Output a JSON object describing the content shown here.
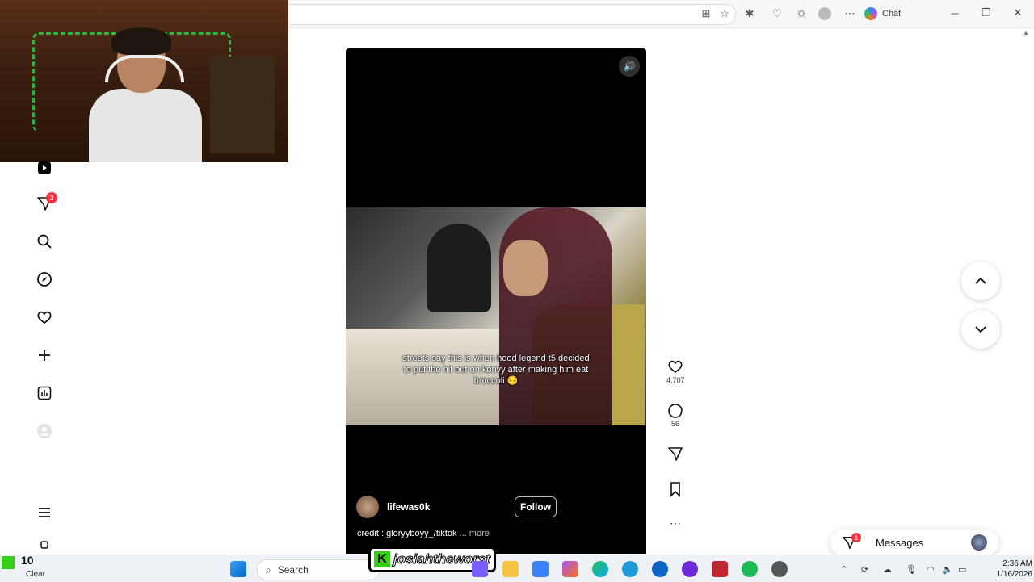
{
  "browser": {
    "chat_label": "Chat"
  },
  "sidebar": {
    "notification_count": "1",
    "items": [
      "reels-icon",
      "direct-icon",
      "search-icon",
      "explore-icon",
      "notifications-icon",
      "create-icon",
      "dashboard-icon",
      "profile-icon",
      "menu-icon"
    ]
  },
  "reel": {
    "caption_overlay": "streets say this is when hood legend t5 decided to put the hit out on konvy after making him eat broccoli 😔",
    "username": "lifewas0k",
    "follow_label": "Follow",
    "credit_text": "credit : gloryyboyy_/tiktok",
    "more_label": "... more"
  },
  "actions": {
    "likes": "4,707",
    "comments": "56"
  },
  "messages": {
    "label": "Messages",
    "count": "1"
  },
  "overlay": {
    "streamer_name": "josiahtheworst",
    "k_logo": "K"
  },
  "taskbar": {
    "search_placeholder": "Search",
    "weather_temp": "10",
    "weather_desc": "Clear",
    "time": "2:36 AM",
    "date": "1/16/2026"
  }
}
